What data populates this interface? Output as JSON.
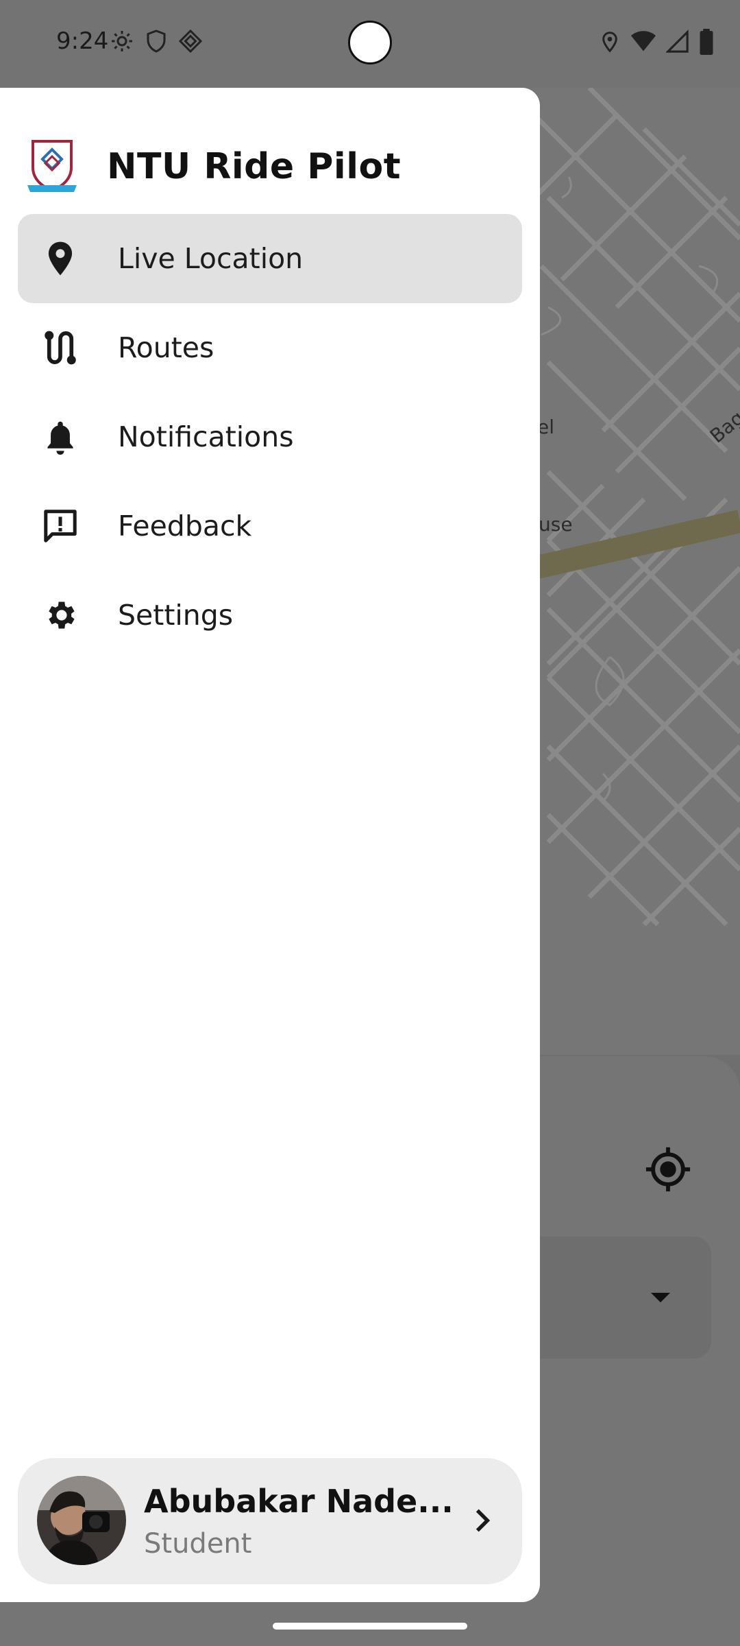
{
  "status_bar": {
    "time": "9:24",
    "left_icons": [
      "gear-icon",
      "shield-icon",
      "nearby-icon"
    ],
    "right_icons": [
      "location-icon",
      "wifi-icon",
      "signal-icon",
      "battery-icon"
    ]
  },
  "map": {
    "labels": [
      "el",
      "use",
      "Bag"
    ],
    "road_color": "#6f6a4d"
  },
  "drawer": {
    "app_title": "NTU Ride Pilot",
    "logo_icon": "ntu-crest-logo",
    "menu": [
      {
        "label": "Live Location",
        "icon": "location-pin-icon",
        "active": true
      },
      {
        "label": "Routes",
        "icon": "route-icon",
        "active": false
      },
      {
        "label": "Notifications",
        "icon": "bell-icon",
        "active": false
      },
      {
        "label": "Feedback",
        "icon": "feedback-icon",
        "active": false
      },
      {
        "label": "Settings",
        "icon": "settings-gear-icon",
        "active": false
      }
    ],
    "profile": {
      "name": "Abubakar Nade...",
      "role": "Student"
    }
  },
  "colors": {
    "drawer_bg": "#ffffff",
    "active_item_bg": "#e1e1e1",
    "scrim": "#6f6f6f",
    "profile_card_bg": "#ececec"
  }
}
